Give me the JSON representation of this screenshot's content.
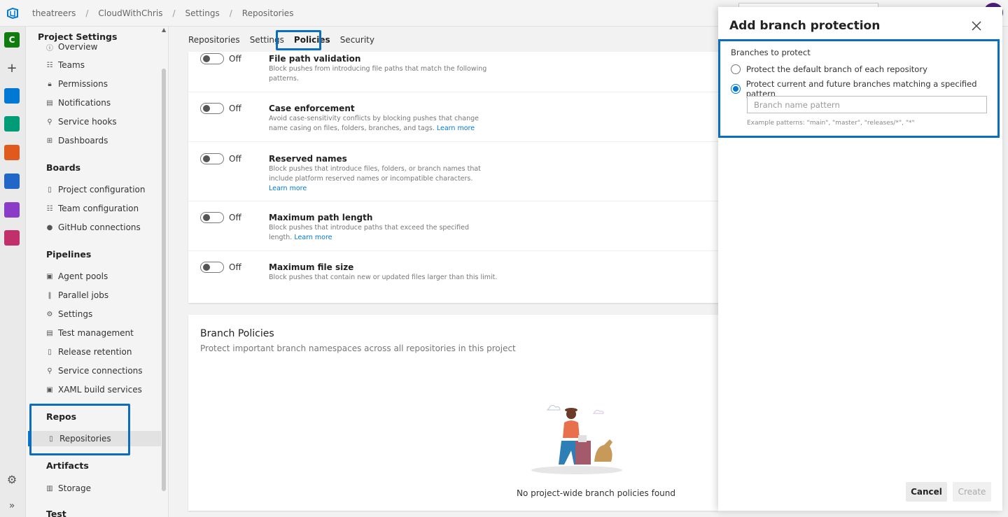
{
  "breadcrumb": {
    "org": "theatreers",
    "project": "CloudWithChris",
    "section": "Settings",
    "page": "Repositories"
  },
  "rail": {
    "project_letter": "C"
  },
  "nav": {
    "title": "Project Settings",
    "general_items": [
      "Overview",
      "Teams",
      "Permissions",
      "Notifications",
      "Service hooks",
      "Dashboards"
    ],
    "boards_label": "Boards",
    "boards_items": [
      "Project configuration",
      "Team configuration",
      "GitHub connections"
    ],
    "pipelines_label": "Pipelines",
    "pipelines_items": [
      "Agent pools",
      "Parallel jobs",
      "Settings",
      "Test management",
      "Release retention",
      "Service connections",
      "XAML build services"
    ],
    "repos_label": "Repos",
    "repos_items": [
      "Repositories"
    ],
    "artifacts_label": "Artifacts",
    "artifacts_items": [
      "Storage"
    ],
    "test_label": "Test"
  },
  "tabs": [
    "Repositories",
    "Settings",
    "Policies",
    "Security"
  ],
  "active_tab": "Policies",
  "policies": [
    {
      "state": "Off",
      "title": "File path validation",
      "desc": "Block pushes from introducing file paths that match the following patterns.",
      "link": ""
    },
    {
      "state": "Off",
      "title": "Case enforcement",
      "desc": "Avoid case-sensitivity conflicts by blocking pushes that change name casing on files, folders, branches, and tags.",
      "link": "Learn more"
    },
    {
      "state": "Off",
      "title": "Reserved names",
      "desc": "Block pushes that introduce files, folders, or branch names that include platform reserved names or incompatible characters.",
      "link": "Learn more"
    },
    {
      "state": "Off",
      "title": "Maximum path length",
      "desc": "Block pushes that introduce paths that exceed the specified length.",
      "link": "Learn more"
    },
    {
      "state": "Off",
      "title": "Maximum file size",
      "desc": "Block pushes that contain new or updated files larger than this limit.",
      "link": ""
    }
  ],
  "branch_policies": {
    "title": "Branch Policies",
    "subtitle": "Protect important branch namespaces across all repositories in this project",
    "empty_message": "No project-wide branch policies found"
  },
  "panel": {
    "title": "Add branch protection",
    "section_label": "Branches to protect",
    "option_default": "Protect the default branch of each repository",
    "option_pattern": "Protect current and future branches matching a specified pattern",
    "selected_option": "pattern",
    "pattern_placeholder": "Branch name pattern",
    "pattern_value": "",
    "example_text": "Example patterns: \"main\", \"master\", \"releases/*\", \"*\"",
    "cancel_label": "Cancel",
    "create_label": "Create"
  },
  "colors": {
    "accent": "#0078d4",
    "highlight": "#0a6dbf"
  }
}
